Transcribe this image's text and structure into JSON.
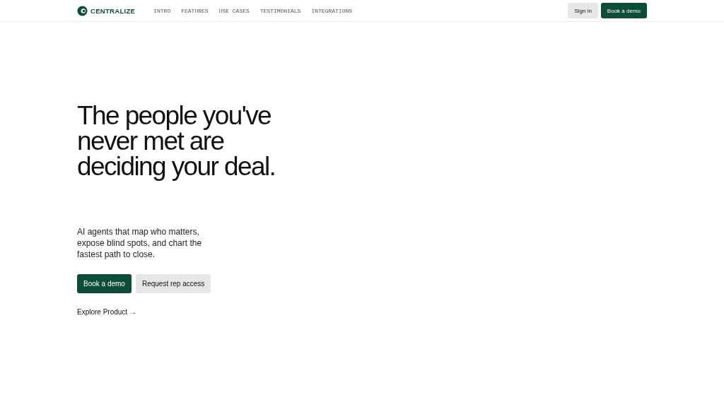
{
  "header": {
    "logo": "CENTRALIZE",
    "nav": [
      "INTRO",
      "FEATURES",
      "USE CASES",
      "TESTIMONIALS",
      "INTEGRATIONS"
    ],
    "actions": [
      {
        "label": "Sign in",
        "kind": "secondary"
      },
      {
        "label": "Book a demo",
        "kind": "primary"
      }
    ]
  },
  "hero": {
    "headline": "The people you've never met are deciding your deal.",
    "subtitle": "AI agents that map who matters, expose blind spots, and chart the fastest path to close.",
    "buttons": [
      {
        "label": "Book a demo",
        "kind": "primary"
      },
      {
        "label": "Request rep access",
        "kind": "secondary"
      }
    ],
    "link": "Explore Product →"
  }
}
